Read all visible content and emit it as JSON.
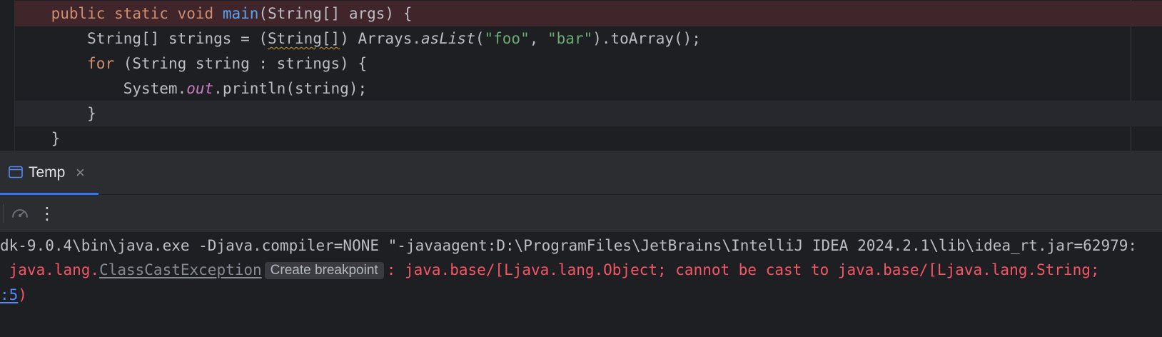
{
  "editor": {
    "line1": {
      "indent": "    ",
      "kw_public": "public",
      "kw_static": "static",
      "kw_void": "void",
      "method": "main",
      "params": "(String[] args) {"
    },
    "line2": {
      "indent": "        ",
      "decl": "String[] strings = (",
      "cast_type": "String[]",
      "after_cast": ") Arrays.",
      "as_list": "asList",
      "open": "(",
      "str_foo": "\"foo\"",
      "comma": ", ",
      "str_bar": "\"bar\"",
      "close": ").toArray();"
    },
    "line3": {
      "indent": "        ",
      "kw_for": "for",
      "rest": " (String string : strings) {"
    },
    "line4": {
      "indent": "            ",
      "system": "System.",
      "out": "out",
      "rest": ".println(string);"
    },
    "line5": {
      "text": "        }"
    },
    "line6": {
      "text": "    }"
    }
  },
  "run_panel": {
    "tab_label": "Temp",
    "close_glyph": "×",
    "menu_glyph": "⋮",
    "icons": {
      "tab_icon": "console-window-icon",
      "debug_icon": "speedometer-icon",
      "menu_icon": "more-vertical-icon"
    }
  },
  "console": {
    "command": "dk-9.0.4\\bin\\java.exe -Djava.compiler=NONE \"-javaagent:D:\\ProgramFiles\\JetBrains\\IntelliJ IDEA 2024.2.1\\lib\\idea_rt.jar=62979:",
    "exception_prefix": " java.lang.",
    "exception_class": "ClassCastException",
    "create_breakpoint": "Create breakpoint",
    "exception_message": ": java.base/[Ljava.lang.Object; cannot be cast to java.base/[Ljava.lang.String;",
    "location_link": ":5",
    "location_close": ")"
  },
  "colors": {
    "editor_bg": "#1e1f22",
    "panel_bg": "#2b2d30",
    "breakpoint_line": "#40252b",
    "keyword": "#cf8e6d",
    "method": "#56a8f5",
    "string": "#6aab73",
    "field": "#c77dbb",
    "error": "#f75464",
    "link": "#548af7",
    "accent": "#3574f0"
  }
}
